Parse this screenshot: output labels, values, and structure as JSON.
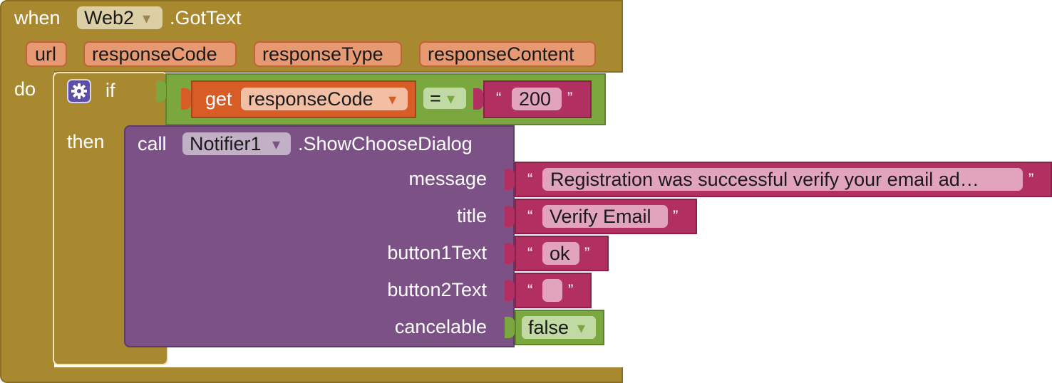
{
  "event": {
    "keyword": "when",
    "component": "Web2",
    "event_name": ".GotText",
    "params": [
      "url",
      "responseCode",
      "responseType",
      "responseContent"
    ],
    "do_label": "do"
  },
  "if_block": {
    "if_label": "if",
    "then_label": "then",
    "get_label": "get",
    "variable": "responseCode",
    "operator": "=",
    "open_quote": "“",
    "close_quote": "”",
    "compare_value": "200"
  },
  "call": {
    "call_label": "call",
    "component": "Notifier1",
    "method": ".ShowChooseDialog",
    "message_label": "message",
    "message_value": "Registration was successful verify your email ad…",
    "title_label": "title",
    "title_value": "Verify Email",
    "button1_label": "button1Text",
    "button1_value": "ok",
    "button2_label": "button2Text",
    "button2_value": "",
    "cancelable_label": "cancelable",
    "cancelable_value": "false"
  },
  "icons": {
    "dropdown": "▾",
    "mutator": "gear-icon"
  },
  "colors": {
    "event": "#a8892f",
    "logic": "#7aa83f",
    "variable": "#d75c25",
    "text": "#b23061",
    "component": "#7b5186"
  }
}
